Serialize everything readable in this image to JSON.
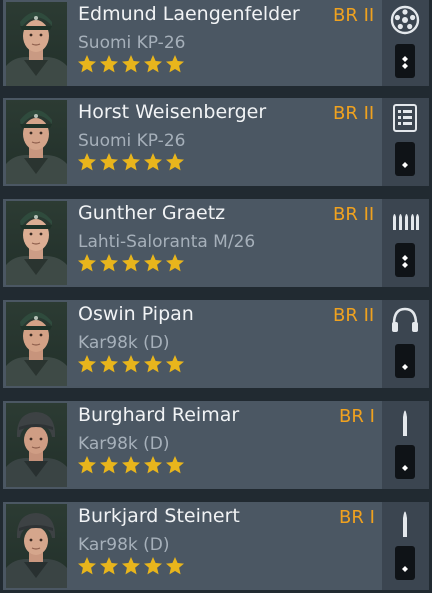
{
  "colors": {
    "accent_br": "#f0a21f",
    "star": "#e8b51c",
    "card_bg": "#4b5763",
    "side_bg": "#3b4550"
  },
  "soldiers": [
    {
      "name": "Edmund Laengenfelder",
      "weapon": "Suomi KP-26",
      "br": "BR II",
      "stars": 5,
      "class_icon": "assaulter-drum-icon",
      "rank_pips": 2,
      "helmet": "cap"
    },
    {
      "name": "Horst Weisenberger",
      "weapon": "Suomi KP-26",
      "br": "BR II",
      "stars": 5,
      "class_icon": "radio-operator-list-icon",
      "rank_pips": 1,
      "helmet": "cap"
    },
    {
      "name": "Gunther Graetz",
      "weapon": "Lahti-Saloranta M/26",
      "br": "BR II",
      "stars": 5,
      "class_icon": "machine-gunner-ammo-icon",
      "rank_pips": 2,
      "helmet": "cap"
    },
    {
      "name": "Oswin Pipan",
      "weapon": "Kar98k (D)",
      "br": "BR II",
      "stars": 5,
      "class_icon": "headphones-icon",
      "rank_pips": 1,
      "helmet": "cap"
    },
    {
      "name": "Burghard Reimar",
      "weapon": "Kar98k (D)",
      "br": "BR I",
      "stars": 5,
      "class_icon": "rifleman-bullet-icon",
      "rank_pips": 1,
      "helmet": "helmet"
    },
    {
      "name": "Burkjard Steinert",
      "weapon": "Kar98k (D)",
      "br": "BR I",
      "stars": 5,
      "class_icon": "rifleman-bullet-icon",
      "rank_pips": 1,
      "helmet": "helmet"
    }
  ]
}
